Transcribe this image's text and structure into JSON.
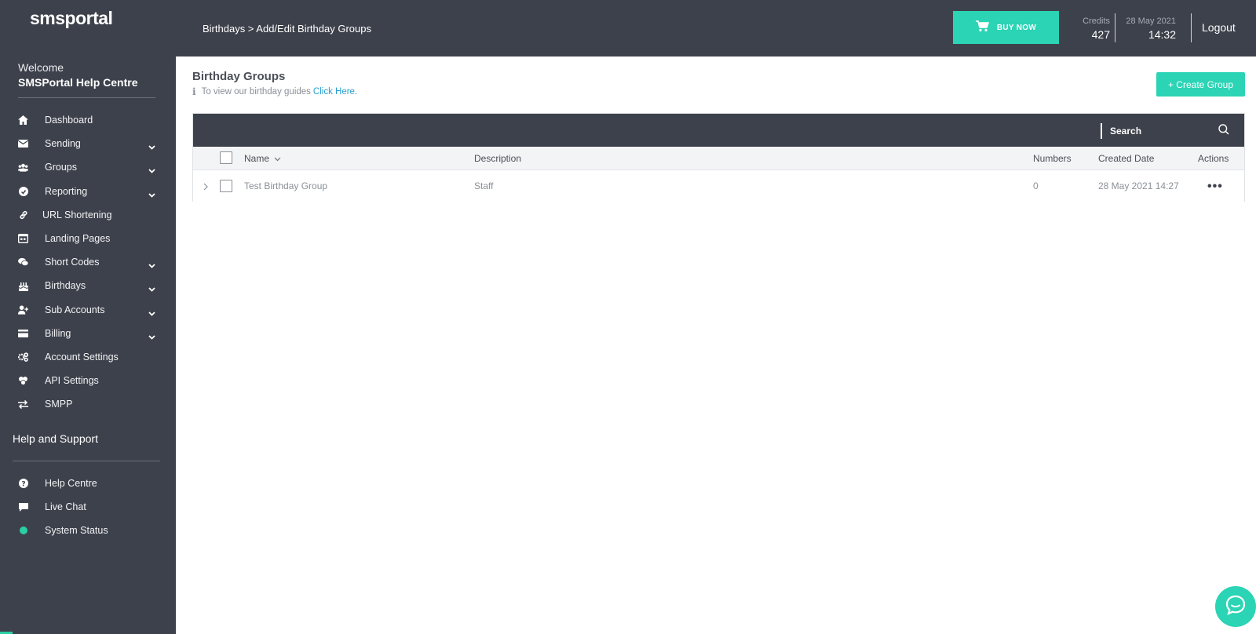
{
  "brand": {
    "logo_text_a": "smsp",
    "logo_text_b": "ortal",
    "accent": "#2bd4b4",
    "sidebar_bg": "#3d414b"
  },
  "sidebar": {
    "welcome": "Welcome",
    "account_name": "SMSPortal Help Centre",
    "items": [
      {
        "label": "Dashboard",
        "icon": "home-icon",
        "expandable": false
      },
      {
        "label": "Sending",
        "icon": "envelope-icon",
        "expandable": true
      },
      {
        "label": "Groups",
        "icon": "users-icon",
        "expandable": true
      },
      {
        "label": "Reporting",
        "icon": "reporting-icon",
        "expandable": true
      },
      {
        "label": "URL Shortening",
        "icon": "link-icon",
        "expandable": false
      },
      {
        "label": "Landing Pages",
        "icon": "landing-page-icon",
        "expandable": false
      },
      {
        "label": "Short Codes",
        "icon": "comments-icon",
        "expandable": true
      },
      {
        "label": "Birthdays",
        "icon": "cake-icon",
        "expandable": true
      },
      {
        "label": "Sub Accounts",
        "icon": "user-plus-icon",
        "expandable": true
      },
      {
        "label": "Billing",
        "icon": "credit-card-icon",
        "expandable": true
      },
      {
        "label": "Account Settings",
        "icon": "cogs-icon",
        "expandable": false
      },
      {
        "label": "API Settings",
        "icon": "api-icon",
        "expandable": false
      },
      {
        "label": "SMPP",
        "icon": "exchange-icon",
        "expandable": false
      }
    ],
    "help_title": "Help and Support",
    "help_items": [
      {
        "label": "Help Centre",
        "icon": "question-icon"
      },
      {
        "label": "Live Chat",
        "icon": "chat-icon"
      },
      {
        "label": "System Status",
        "icon": "status-dot-icon"
      }
    ]
  },
  "topbar": {
    "breadcrumb": "Birthdays > Add/Edit Birthday Groups",
    "buy_label": "BUY NOW",
    "credits_label": "Credits",
    "credits_value": "427",
    "date": "28 May 2021",
    "time": "14:32",
    "logout": "Logout"
  },
  "main": {
    "title": "Birthday Groups",
    "guide_text": "To view our birthday guides",
    "guide_link": "Click Here.",
    "create_label": "+ Create Group",
    "search_placeholder": "Search",
    "columns": {
      "name": "Name",
      "description": "Description",
      "numbers": "Numbers",
      "created": "Created Date",
      "actions": "Actions"
    },
    "rows": [
      {
        "name": "Test Birthday Group",
        "description": "Staff",
        "numbers": "0",
        "created": "28 May 2021 14:27",
        "actions": "•••"
      }
    ]
  }
}
